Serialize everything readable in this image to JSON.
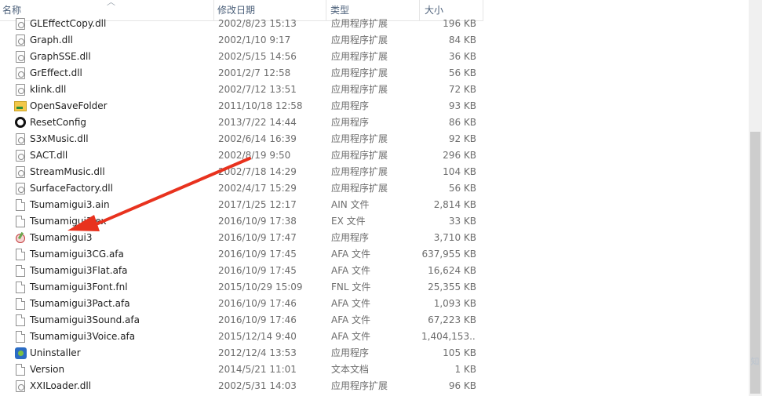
{
  "columns": {
    "name": "名称",
    "date": "修改日期",
    "type": "类型",
    "size": "大小"
  },
  "files": [
    {
      "name": "GLEffectCopy.dll",
      "date": "2002/8/23 15:13",
      "type": "应用程序扩展",
      "size": "196 KB",
      "icon": "dll-icon"
    },
    {
      "name": "Graph.dll",
      "date": "2002/1/10 9:17",
      "type": "应用程序扩展",
      "size": "84 KB",
      "icon": "dll-icon"
    },
    {
      "name": "GraphSSE.dll",
      "date": "2002/5/15 14:56",
      "type": "应用程序扩展",
      "size": "36 KB",
      "icon": "dll-icon"
    },
    {
      "name": "GrEffect.dll",
      "date": "2001/2/7 12:58",
      "type": "应用程序扩展",
      "size": "56 KB",
      "icon": "dll-icon"
    },
    {
      "name": "klink.dll",
      "date": "2002/7/12 13:51",
      "type": "应用程序扩展",
      "size": "72 KB",
      "icon": "dll-icon"
    },
    {
      "name": "OpenSaveFolder",
      "date": "2011/10/18 12:58",
      "type": "应用程序",
      "size": "93 KB",
      "icon": "folder-app-icon"
    },
    {
      "name": "ResetConfig",
      "date": "2013/7/22 14:44",
      "type": "应用程序",
      "size": "86 KB",
      "icon": "reset-app-icon"
    },
    {
      "name": "S3xMusic.dll",
      "date": "2002/6/14 16:39",
      "type": "应用程序扩展",
      "size": "92 KB",
      "icon": "dll-icon"
    },
    {
      "name": "SACT.dll",
      "date": "2002/8/19 9:50",
      "type": "应用程序扩展",
      "size": "296 KB",
      "icon": "dll-icon"
    },
    {
      "name": "StreamMusic.dll",
      "date": "2002/7/18 14:29",
      "type": "应用程序扩展",
      "size": "104 KB",
      "icon": "dll-icon"
    },
    {
      "name": "SurfaceFactory.dll",
      "date": "2002/4/17 15:29",
      "type": "应用程序扩展",
      "size": "56 KB",
      "icon": "dll-icon"
    },
    {
      "name": "Tsumamigui3.ain",
      "date": "2017/1/25 12:17",
      "type": "AIN 文件",
      "size": "2,814 KB",
      "icon": "file-icon"
    },
    {
      "name": "Tsumamigui3.ex",
      "date": "2016/10/9 17:38",
      "type": "EX 文件",
      "size": "33 KB",
      "icon": "file-icon"
    },
    {
      "name": "Tsumamigui3",
      "date": "2016/10/9 17:47",
      "type": "应用程序",
      "size": "3,710 KB",
      "icon": "game-exe-icon"
    },
    {
      "name": "Tsumamigui3CG.afa",
      "date": "2016/10/9 17:45",
      "type": "AFA 文件",
      "size": "637,955 KB",
      "icon": "file-icon"
    },
    {
      "name": "Tsumamigui3Flat.afa",
      "date": "2016/10/9 17:45",
      "type": "AFA 文件",
      "size": "16,624 KB",
      "icon": "file-icon"
    },
    {
      "name": "Tsumamigui3Font.fnl",
      "date": "2015/10/29 15:09",
      "type": "FNL 文件",
      "size": "25,355 KB",
      "icon": "file-icon"
    },
    {
      "name": "Tsumamigui3Pact.afa",
      "date": "2016/10/9 17:46",
      "type": "AFA 文件",
      "size": "1,093 KB",
      "icon": "file-icon"
    },
    {
      "name": "Tsumamigui3Sound.afa",
      "date": "2016/10/9 17:46",
      "type": "AFA 文件",
      "size": "67,223 KB",
      "icon": "file-icon"
    },
    {
      "name": "Tsumamigui3Voice.afa",
      "date": "2015/12/14 9:40",
      "type": "AFA 文件",
      "size": "1,404,153...",
      "icon": "file-icon"
    },
    {
      "name": "Uninstaller",
      "date": "2012/12/4 13:53",
      "type": "应用程序",
      "size": "105 KB",
      "icon": "uninstaller-icon"
    },
    {
      "name": "Version",
      "date": "2014/5/21 11:01",
      "type": "文本文档",
      "size": "1 KB",
      "icon": "file-icon"
    },
    {
      "name": "XXILoader.dll",
      "date": "2002/5/31 14:03",
      "type": "应用程序扩展",
      "size": "96 KB",
      "icon": "dll-icon"
    }
  ],
  "annotation": {
    "arrow_color": "#e8321e"
  },
  "watermark_text": "知"
}
